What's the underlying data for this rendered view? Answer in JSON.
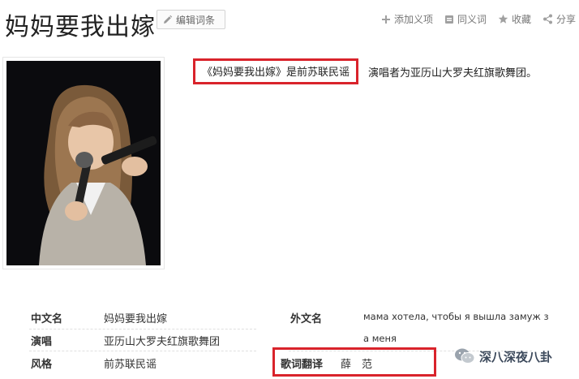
{
  "header": {
    "title": "妈妈要我出嫁",
    "edit_label": "编辑词条",
    "actions": {
      "add_meaning": "添加义项",
      "synonym": "同义词",
      "favorite": "收藏",
      "share": "分享"
    }
  },
  "summary": {
    "highlighted": "《妈妈要我出嫁》是前苏联民谣",
    "rest": "演唱者为亚历山大罗夫红旗歌舞团。"
  },
  "basic_info": {
    "chinese_name_label": "中文名",
    "chinese_name_value": "妈妈要我出嫁",
    "singer_label": "演唱",
    "singer_value": "亚历山大罗夫红旗歌舞团",
    "style_label": "风格",
    "style_value": "前苏联民谣",
    "foreign_name_label": "外文名",
    "foreign_name_value_line1": "мама хотела, чтобы я вышла замуж з",
    "foreign_name_value_line2": "а меня",
    "translation_label": "歌词翻译",
    "translation_value": "薛　范"
  },
  "watermark": {
    "text": "深八深夜八卦"
  },
  "colors": {
    "highlight_border": "#d9232b",
    "text": "#333333"
  }
}
